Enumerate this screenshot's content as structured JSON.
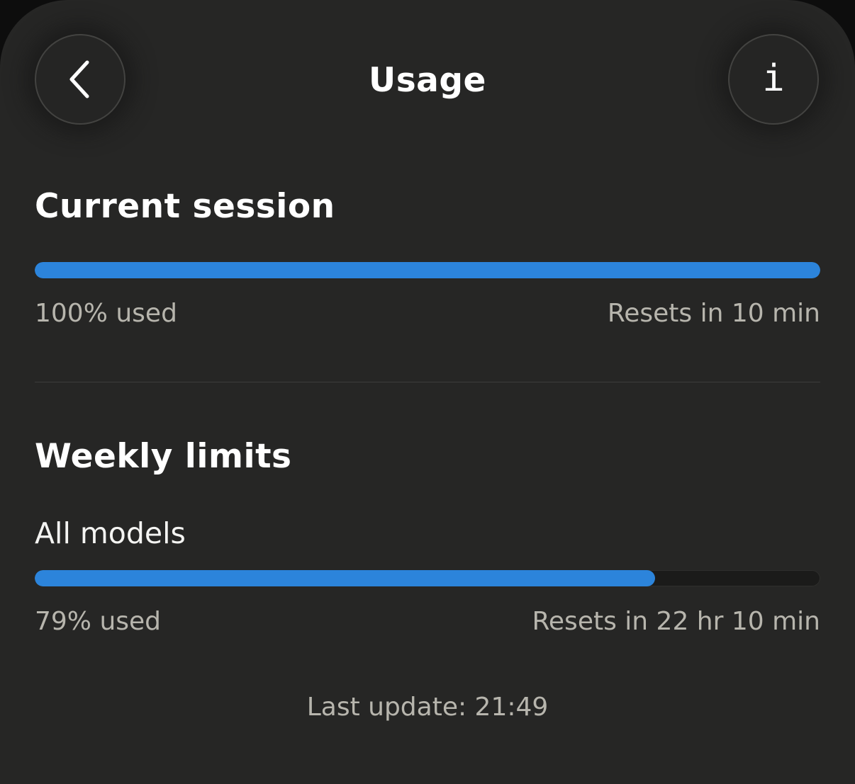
{
  "header": {
    "title": "Usage",
    "back_icon": "chevron-left-icon",
    "info_icon": "info-icon",
    "info_glyph": "i"
  },
  "current_session": {
    "title": "Current session",
    "progress": 1.0,
    "used_label": "100% used",
    "reset_label": "Resets in 10 min"
  },
  "weekly_limits": {
    "title": "Weekly limits",
    "all_models": {
      "label": "All models",
      "progress": 0.79,
      "used_label": "79% used",
      "reset_label": "Resets in 22 hr 10 min"
    }
  },
  "footer": {
    "last_update": "Last update: 21:49"
  },
  "colors": {
    "background": "#262625",
    "accent": "#2c84db",
    "muted_text": "#b7b5ad"
  }
}
